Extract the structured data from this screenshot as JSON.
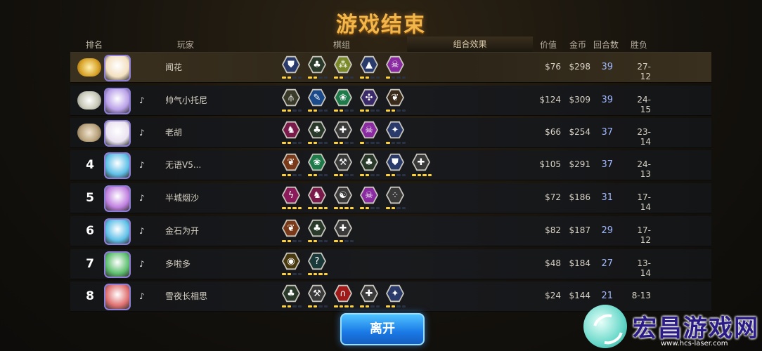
{
  "title": "游戏结束",
  "headers": {
    "rank": "排名",
    "player": "玩家",
    "pieces": "棋组",
    "synergy": "组合效果",
    "value": "价值",
    "gold": "金币",
    "rounds": "回合数",
    "record": "胜负"
  },
  "leave_button": "离开",
  "watermark": {
    "name": "宏昌游戏网",
    "url": "www.hcs-laser.com"
  },
  "rows": [
    {
      "rank": "",
      "medal": "gold",
      "avatar_color": "#f3e0c0",
      "name": "闻花",
      "value": "$76",
      "gold": "$298",
      "rounds": "39",
      "record": "27-12",
      "synergies": [
        {
          "icon": "wizard-hat",
          "color": "#2a3a6a",
          "pips": [
            1,
            1,
            0,
            0
          ]
        },
        {
          "icon": "clover",
          "color": "#2a3a2a",
          "pips": [
            1,
            1,
            0,
            0
          ]
        },
        {
          "icon": "triad",
          "color": "#7a8a2a",
          "pips": [
            1,
            1,
            0,
            0
          ]
        },
        {
          "icon": "witch-hat",
          "color": "#2a3a6a",
          "pips": [
            1,
            1,
            0,
            0
          ]
        },
        {
          "icon": "demon",
          "color": "#8a2aa0",
          "pips": [
            1,
            0,
            0,
            0
          ]
        }
      ]
    },
    {
      "rank": "",
      "medal": "silver",
      "avatar_color": "#b9a0e8",
      "name": "帅气小托尼",
      "value": "$124",
      "gold": "$309",
      "rounds": "39",
      "record": "24-15",
      "synergies": [
        {
          "icon": "tridents",
          "color": "#3a3a2a",
          "pips": [
            1,
            1,
            0,
            0
          ]
        },
        {
          "icon": "feather",
          "color": "#1a4a8a",
          "pips": [
            1,
            1,
            0,
            0
          ]
        },
        {
          "icon": "paw",
          "color": "#1f7a4a",
          "pips": [
            1,
            1,
            0,
            0
          ]
        },
        {
          "icon": "fishbone",
          "color": "#3a2a6a",
          "pips": [
            1,
            1,
            0,
            0
          ]
        },
        {
          "icon": "leaf",
          "color": "#3a2a1a",
          "pips": [
            1,
            1,
            0,
            0
          ]
        }
      ]
    },
    {
      "rank": "",
      "medal": "bronze",
      "avatar_color": "#eae2f0",
      "name": "老胡",
      "value": "$66",
      "gold": "$254",
      "rounds": "37",
      "record": "23-14",
      "synergies": [
        {
          "icon": "knight",
          "color": "#7a1a4a",
          "pips": [
            1,
            1,
            0,
            0
          ]
        },
        {
          "icon": "clover",
          "color": "#2a3a2a",
          "pips": [
            1,
            1,
            0,
            0
          ]
        },
        {
          "icon": "cross",
          "color": "#3a3a3a",
          "pips": [
            1,
            1,
            0,
            0
          ]
        },
        {
          "icon": "demon",
          "color": "#8a2aa0",
          "pips": [
            1,
            0,
            0,
            0
          ]
        },
        {
          "icon": "shuriken",
          "color": "#2a3a6a",
          "pips": [
            1,
            0,
            0,
            0
          ]
        }
      ]
    },
    {
      "rank": "4",
      "medal": "",
      "avatar_color": "#5fc0e8",
      "name": "无语V5...",
      "value": "$105",
      "gold": "$291",
      "rounds": "37",
      "record": "24-13",
      "synergies": [
        {
          "icon": "leaf",
          "color": "#7a3a1a",
          "pips": [
            1,
            1,
            0,
            0
          ]
        },
        {
          "icon": "paw",
          "color": "#1f7a4a",
          "pips": [
            1,
            1,
            0,
            0
          ]
        },
        {
          "icon": "axe",
          "color": "#3a3a3a",
          "pips": [
            1,
            1,
            0,
            0
          ]
        },
        {
          "icon": "clover",
          "color": "#2a3a2a",
          "pips": [
            1,
            1,
            0,
            0
          ]
        },
        {
          "icon": "wizard-hat",
          "color": "#2a3a6a",
          "pips": [
            1,
            1,
            0,
            0
          ]
        },
        {
          "icon": "cross",
          "color": "#3a3a3a",
          "pips": [
            1,
            1,
            1,
            1
          ]
        }
      ]
    },
    {
      "rank": "5",
      "medal": "",
      "avatar_color": "#c080e0",
      "name": "半城烟沙",
      "value": "$72",
      "gold": "$186",
      "rounds": "31",
      "record": "17-14",
      "synergies": [
        {
          "icon": "bolt",
          "color": "#8a1a5a",
          "pips": [
            1,
            1,
            1,
            1
          ]
        },
        {
          "icon": "knight",
          "color": "#7a1a4a",
          "pips": [
            1,
            1,
            1,
            1
          ]
        },
        {
          "icon": "yin",
          "color": "#3a3a3a",
          "pips": [
            1,
            1,
            1,
            1
          ]
        },
        {
          "icon": "demon",
          "color": "#8a2aa0",
          "pips": [
            1,
            1,
            0,
            0
          ]
        },
        {
          "icon": "dots",
          "color": "#3a3a3a",
          "pips": [
            1,
            1,
            0,
            0
          ]
        }
      ]
    },
    {
      "rank": "6",
      "medal": "",
      "avatar_color": "#5fc0e8",
      "name": "金石为开",
      "value": "$82",
      "gold": "$187",
      "rounds": "29",
      "record": "17-12",
      "synergies": [
        {
          "icon": "leaf",
          "color": "#7a3a1a",
          "pips": [
            1,
            1,
            0,
            0
          ]
        },
        {
          "icon": "clover",
          "color": "#2a3a2a",
          "pips": [
            1,
            1,
            0,
            0
          ]
        },
        {
          "icon": "cross",
          "color": "#3a3a3a",
          "pips": [
            1,
            1,
            0,
            0
          ]
        }
      ]
    },
    {
      "rank": "7",
      "medal": "",
      "avatar_color": "#5fc070",
      "name": "多啦多",
      "value": "$48",
      "gold": "$184",
      "rounds": "27",
      "record": "13-14",
      "synergies": [
        {
          "icon": "orb",
          "color": "#4a3a10",
          "pips": [
            1,
            1,
            0,
            0
          ]
        },
        {
          "icon": "question",
          "color": "#1a3a3a",
          "pips": [
            1,
            1,
            1,
            1
          ]
        }
      ]
    },
    {
      "rank": "8",
      "medal": "",
      "avatar_color": "#e07070",
      "name": "雪夜长相思",
      "value": "$24",
      "gold": "$144",
      "rounds": "21",
      "record": "8-13",
      "synergies": [
        {
          "icon": "clover",
          "color": "#2a3a2a",
          "pips": [
            1,
            1,
            0,
            0
          ]
        },
        {
          "icon": "axe",
          "color": "#3a3a3a",
          "pips": [
            1,
            1,
            0,
            0
          ]
        },
        {
          "icon": "arch",
          "color": "#a01a1a",
          "pips": [
            1,
            1,
            1,
            1
          ]
        },
        {
          "icon": "cross",
          "color": "#3a3a3a",
          "pips": [
            1,
            1,
            0,
            0
          ]
        },
        {
          "icon": "shuriken",
          "color": "#2a3a6a",
          "pips": [
            1,
            1,
            0,
            0
          ]
        }
      ]
    }
  ]
}
